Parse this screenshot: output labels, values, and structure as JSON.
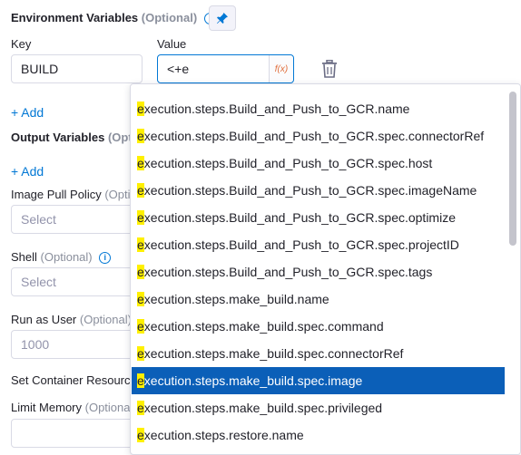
{
  "env_vars": {
    "title": "Environment Variables",
    "optional": "(Optional)",
    "key_header": "Key",
    "value_header": "Value",
    "key_value": "BUILD",
    "value_value": "<+e",
    "fx_label": "f(x)",
    "add_label": "+ Add"
  },
  "output_vars": {
    "title": "Output Variables",
    "optional_partial": "(Optio",
    "add_label": "+ Add"
  },
  "image_pull_policy": {
    "label": "Image Pull Policy",
    "optional_partial": "(Optio",
    "placeholder": "Select"
  },
  "shell": {
    "label": "Shell",
    "optional": "(Optional)",
    "placeholder": "Select"
  },
  "run_as_user": {
    "label": "Run as User",
    "optional": "(Optional)",
    "placeholder": "1000"
  },
  "container_resources": {
    "label_partial": "Set Container Resource"
  },
  "limit_memory": {
    "label": "Limit Memory",
    "optional_partial": "(Optiona"
  },
  "autocomplete": {
    "highlight_prefix": "e",
    "selected_index": 10,
    "options": [
      "execution.steps.Build_and_Push_to_GCR.name",
      "execution.steps.Build_and_Push_to_GCR.spec.connectorRef",
      "execution.steps.Build_and_Push_to_GCR.spec.host",
      "execution.steps.Build_and_Push_to_GCR.spec.imageName",
      "execution.steps.Build_and_Push_to_GCR.spec.optimize",
      "execution.steps.Build_and_Push_to_GCR.spec.projectID",
      "execution.steps.Build_and_Push_to_GCR.spec.tags",
      "execution.steps.make_build.name",
      "execution.steps.make_build.spec.command",
      "execution.steps.make_build.spec.connectorRef",
      "execution.steps.make_build.spec.image",
      "execution.steps.make_build.spec.privileged",
      "execution.steps.restore.name"
    ]
  },
  "colors": {
    "accent": "#0278d5",
    "selected_bg": "#0b5fb8",
    "highlight": "#fff000"
  },
  "icons": {
    "info": "info-icon",
    "pin": "pin-icon",
    "delete": "trash-icon",
    "fx": "fx-icon"
  }
}
